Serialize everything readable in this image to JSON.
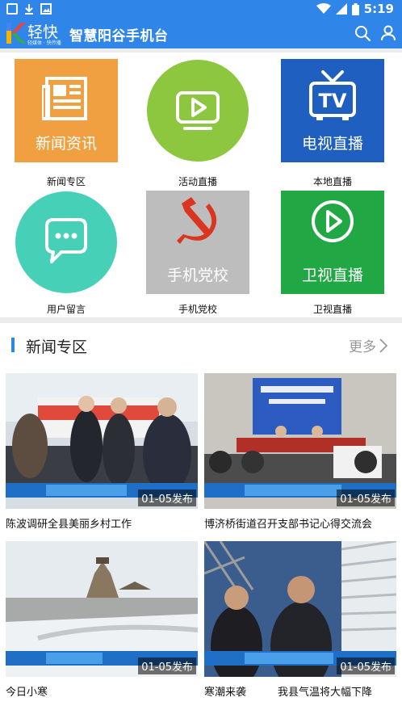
{
  "status_bar": {
    "time": "5:19",
    "icons": [
      "app-notification-icon",
      "download-icon",
      "gallery-icon",
      "wifi-icon",
      "signal-icon",
      "battery-icon"
    ]
  },
  "app_bar": {
    "logo_text": "轻快",
    "logo_tagline": "轻媒体 · 快传播",
    "title": "智慧阳谷手机台",
    "icons": [
      "search-icon",
      "user-icon"
    ],
    "color": "#2f86e8"
  },
  "tiles": [
    {
      "caption": "新闻专区",
      "label": "新闻资讯",
      "icon": "newspaper-icon",
      "color": "#f0a040"
    },
    {
      "caption": "活动直播",
      "label": "",
      "icon": "play-screen-icon",
      "color": "#8dc63f"
    },
    {
      "caption": "本地直播",
      "label": "电视直播",
      "icon": "tv-icon",
      "color": "#1f5fbf"
    },
    {
      "caption": "用户留言",
      "label": "",
      "icon": "chat-bubble-icon",
      "color": "#46d0b8"
    },
    {
      "caption": "手机党校",
      "label": "手机党校",
      "icon": "hammer-sickle-icon",
      "color": "#bdbdbd"
    },
    {
      "caption": "卫视直播",
      "label": "卫视直播",
      "icon": "play-circle-icon",
      "color": "#21a845"
    }
  ],
  "news_section": {
    "title": "新闻专区",
    "more_label": "更多",
    "items": [
      {
        "title": "陈波调研全县美丽乡村工作",
        "date_badge": "01-05发布"
      },
      {
        "title": "博济桥街道召开支部书记心得交流会",
        "date_badge": "01-05发布"
      },
      {
        "title": "今日小寒",
        "date_badge": "01-05发布"
      },
      {
        "title": "寒潮来袭　　　我县气温将大幅下降",
        "date_badge": "01-05发布"
      }
    ]
  }
}
